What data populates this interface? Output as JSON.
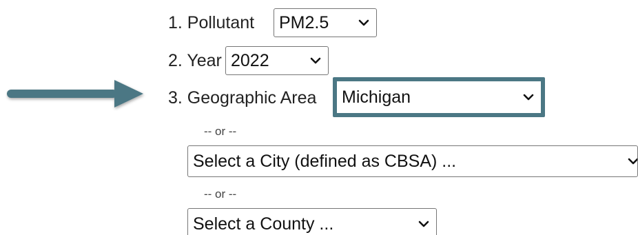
{
  "form": {
    "pollutant": {
      "label": "1. Pollutant",
      "selected": "PM2.5"
    },
    "year": {
      "label": "2. Year",
      "selected": "2022"
    },
    "geographic_area": {
      "label": "3. Geographic Area",
      "selected": "Michigan"
    },
    "separator_1": "-- or --",
    "city": {
      "selected": "Select a City (defined as CBSA) ..."
    },
    "separator_2": "-- or --",
    "county": {
      "selected": "Select a County ..."
    }
  },
  "colors": {
    "highlight": "#4b7784",
    "arrow": "#4b7784"
  },
  "icons": {
    "dropdown": "chevron-down-icon",
    "pointer": "right-arrow-icon"
  }
}
